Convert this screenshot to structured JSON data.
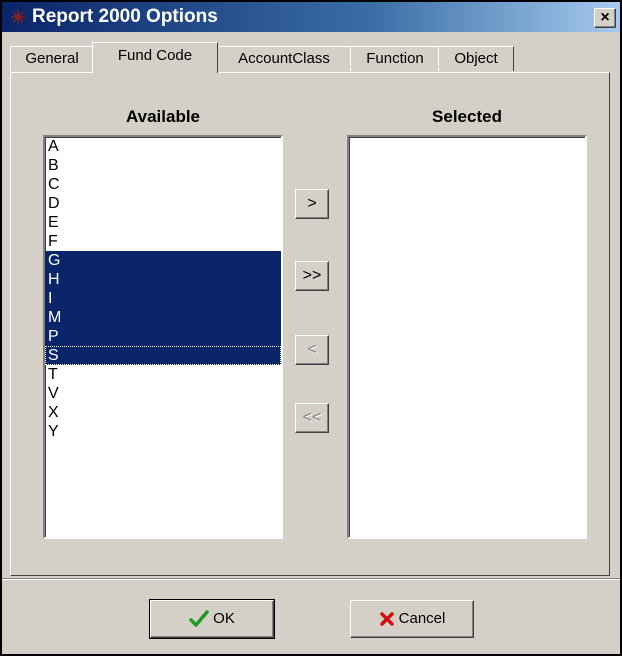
{
  "window": {
    "title": "Report 2000 Options",
    "close_label": "×"
  },
  "tabs": [
    {
      "label": "General"
    },
    {
      "label": "Fund Code"
    },
    {
      "label": "AccountClass"
    },
    {
      "label": "Function"
    },
    {
      "label": "Object"
    }
  ],
  "active_tab": "Fund Code",
  "available": {
    "header": "Available",
    "items": [
      "A",
      "B",
      "C",
      "D",
      "E",
      "F",
      "G",
      "H",
      "I",
      "M",
      "P",
      "S",
      "T",
      "V",
      "X",
      "Y"
    ],
    "selected_items": [
      "G",
      "H",
      "I",
      "M",
      "P",
      "S"
    ],
    "focused_item": "S"
  },
  "selected": {
    "header": "Selected",
    "items": []
  },
  "move_buttons": {
    "add_one": "&gt;",
    "add_all": "&gt;&gt;",
    "remove_one": "&lt;",
    "remove_all": "&lt;&lt;"
  },
  "footer": {
    "ok_label": "OK",
    "cancel_label": "Cancel"
  },
  "colors": {
    "title_start": "#0a246a",
    "selection": "#0a246a",
    "dialog_bg": "#d4d0c8",
    "ok_check": "#1f9a1f",
    "cancel_x": "#d01010"
  },
  "icons": {
    "title": "app-icon",
    "ok": "checkmark-icon",
    "cancel": "x-icon"
  }
}
